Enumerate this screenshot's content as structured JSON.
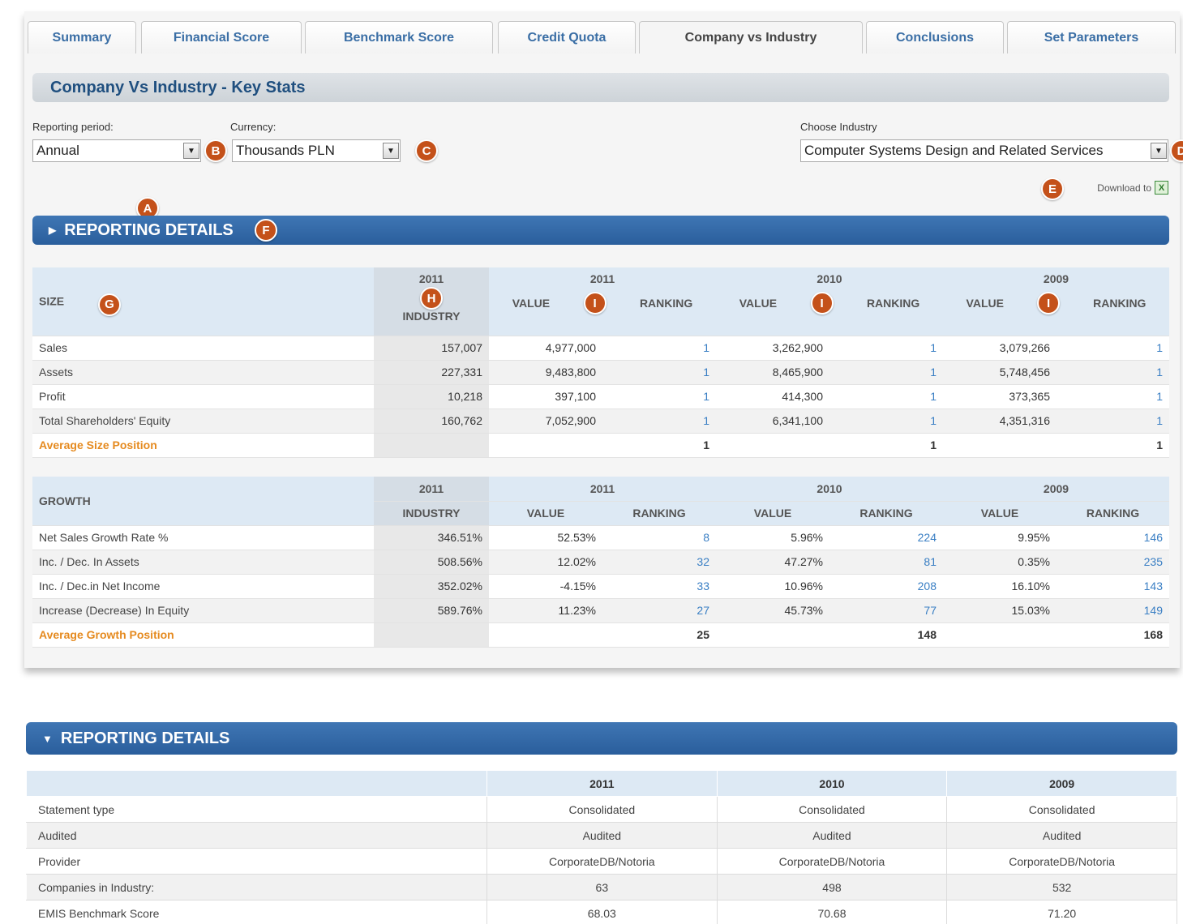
{
  "tabs": [
    {
      "label": "Summary"
    },
    {
      "label": "Financial Score"
    },
    {
      "label": "Benchmark Score"
    },
    {
      "label": "Credit Quota"
    },
    {
      "label": "Company vs Industry"
    },
    {
      "label": "Conclusions"
    },
    {
      "label": "Set Parameters"
    }
  ],
  "active_tab": "Company vs Industry",
  "title": "Company Vs Industry - Key Stats",
  "filters": {
    "reporting_period_label": "Reporting period:",
    "reporting_period_value": "Annual",
    "currency_label": "Currency:",
    "currency_value": "Thousands PLN",
    "industry_label": "Choose Industry",
    "industry_value": "Computer Systems Design and Related Services"
  },
  "download_label": "Download to",
  "markers": {
    "a": "A",
    "b": "B",
    "c": "C",
    "d": "D",
    "e": "E",
    "f": "F",
    "g": "G",
    "h": "H",
    "i": "I"
  },
  "reporting_details_collapsed": "REPORTING DETAILS",
  "reporting_details_expanded": "REPORTING DETAILS",
  "headers": {
    "industry_year": "2011",
    "industry": "INDUSTRY",
    "years": [
      "2011",
      "2010",
      "2009"
    ],
    "value": "VALUE",
    "ranking": "RANKING"
  },
  "size": {
    "title": "SIZE",
    "rows": [
      {
        "label": "Sales",
        "industry": "157,007",
        "cells": [
          [
            "4,977,000",
            "1"
          ],
          [
            "3,262,900",
            "1"
          ],
          [
            "3,079,266",
            "1"
          ]
        ]
      },
      {
        "label": "Assets",
        "industry": "227,331",
        "cells": [
          [
            "9,483,800",
            "1"
          ],
          [
            "8,465,900",
            "1"
          ],
          [
            "5,748,456",
            "1"
          ]
        ]
      },
      {
        "label": "Profit",
        "industry": "10,218",
        "cells": [
          [
            "397,100",
            "1"
          ],
          [
            "414,300",
            "1"
          ],
          [
            "373,365",
            "1"
          ]
        ]
      },
      {
        "label": "Total Shareholders' Equity",
        "industry": "160,762",
        "cells": [
          [
            "7,052,900",
            "1"
          ],
          [
            "6,341,100",
            "1"
          ],
          [
            "4,351,316",
            "1"
          ]
        ]
      }
    ],
    "avg_label": "Average Size Position",
    "avg": [
      "1",
      "1",
      "1"
    ]
  },
  "growth": {
    "title": "GROWTH",
    "rows": [
      {
        "label": "Net Sales Growth Rate %",
        "industry": "346.51%",
        "cells": [
          [
            "52.53%",
            "8"
          ],
          [
            "5.96%",
            "224"
          ],
          [
            "9.95%",
            "146"
          ]
        ]
      },
      {
        "label": "Inc. / Dec. In Assets",
        "industry": "508.56%",
        "cells": [
          [
            "12.02%",
            "32"
          ],
          [
            "47.27%",
            "81"
          ],
          [
            "0.35%",
            "235"
          ]
        ]
      },
      {
        "label": "Inc. / Dec.in Net Income",
        "industry": "352.02%",
        "cells": [
          [
            "-4.15%",
            "33"
          ],
          [
            "10.96%",
            "208"
          ],
          [
            "16.10%",
            "143"
          ]
        ]
      },
      {
        "label": "Increase (Decrease) In Equity",
        "industry": "589.76%",
        "cells": [
          [
            "11.23%",
            "27"
          ],
          [
            "45.73%",
            "77"
          ],
          [
            "15.03%",
            "149"
          ]
        ]
      }
    ],
    "avg_label": "Average Growth Position",
    "avg": [
      "25",
      "148",
      "168"
    ]
  },
  "report": {
    "years": [
      "2011",
      "2010",
      "2009"
    ],
    "rows": [
      {
        "label": "Statement type",
        "values": [
          "Consolidated",
          "Consolidated",
          "Consolidated"
        ]
      },
      {
        "label": "Audited",
        "values": [
          "Audited",
          "Audited",
          "Audited"
        ]
      },
      {
        "label": "Provider",
        "values": [
          "CorporateDB/Notoria",
          "CorporateDB/Notoria",
          "CorporateDB/Notoria"
        ]
      },
      {
        "label": "Companies in Industry:",
        "values": [
          "63",
          "498",
          "532"
        ]
      },
      {
        "label": "EMIS Benchmark Score",
        "values": [
          "68.03",
          "70.68",
          "71.20"
        ]
      }
    ]
  }
}
